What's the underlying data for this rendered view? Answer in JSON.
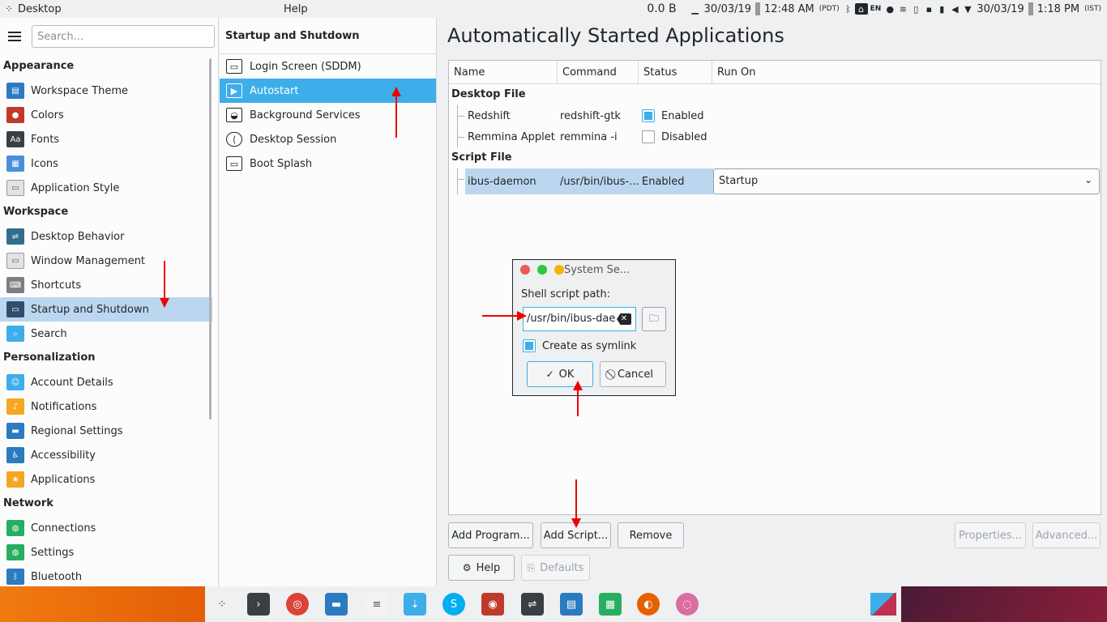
{
  "topbar": {
    "app_name": "Desktop",
    "help_menu": "Help",
    "net_speed": "0.0 B",
    "date_a": "30/03/19",
    "time_a": "12:48 AM",
    "tz_a": "(PDT)",
    "lang": "EN",
    "date_b": "30/03/19",
    "time_b": "1:18 PM",
    "tz_b": "(IST)"
  },
  "sidebar": {
    "search_placeholder": "Search...",
    "categories": [
      {
        "title": "Appearance",
        "items": [
          {
            "label": "Workspace Theme",
            "icon": "workspace-theme-icon",
            "color": "#2a7bbf"
          },
          {
            "label": "Colors",
            "icon": "colors-icon",
            "color": "#c0392b"
          },
          {
            "label": "Fonts",
            "icon": "fonts-icon",
            "color": "#3a3f44"
          },
          {
            "label": "Icons",
            "icon": "icons-icon",
            "color": "#4a90d9"
          },
          {
            "label": "Application Style",
            "icon": "application-style-icon",
            "color": "#dfe3e6"
          }
        ]
      },
      {
        "title": "Workspace",
        "items": [
          {
            "label": "Desktop Behavior",
            "icon": "desktop-behavior-icon",
            "color": "#2f6e8e"
          },
          {
            "label": "Window Management",
            "icon": "window-management-icon",
            "color": "#dfe3e6"
          },
          {
            "label": "Shortcuts",
            "icon": "shortcuts-icon",
            "color": "#7a7f84"
          },
          {
            "label": "Startup and Shutdown",
            "icon": "startup-shutdown-icon",
            "color": "#2f4e6e"
          },
          {
            "label": "Search",
            "icon": "search-icon",
            "color": "#3daee9"
          }
        ]
      },
      {
        "title": "Personalization",
        "items": [
          {
            "label": "Account Details",
            "icon": "account-details-icon",
            "color": "#3daee9"
          },
          {
            "label": "Notifications",
            "icon": "notifications-icon",
            "color": "#f5a623"
          },
          {
            "label": "Regional Settings",
            "icon": "regional-settings-icon",
            "color": "#2a7bbf"
          },
          {
            "label": "Accessibility",
            "icon": "accessibility-icon",
            "color": "#2a7bbf"
          },
          {
            "label": "Applications",
            "icon": "applications-icon",
            "color": "#f5a623"
          }
        ]
      },
      {
        "title": "Network",
        "items": [
          {
            "label": "Connections",
            "icon": "connections-icon",
            "color": "#27ae60"
          },
          {
            "label": "Settings",
            "icon": "network-settings-icon",
            "color": "#27ae60"
          },
          {
            "label": "Bluetooth",
            "icon": "bluetooth-icon",
            "color": "#2a7bbf"
          }
        ]
      }
    ]
  },
  "midpane": {
    "title": "Startup and Shutdown",
    "items": [
      {
        "label": "Login Screen (SDDM)",
        "icon": "login-screen-icon"
      },
      {
        "label": "Autostart",
        "icon": "autostart-icon"
      },
      {
        "label": "Background Services",
        "icon": "background-services-icon"
      },
      {
        "label": "Desktop Session",
        "icon": "desktop-session-icon"
      },
      {
        "label": "Boot Splash",
        "icon": "boot-splash-icon"
      }
    ]
  },
  "main": {
    "title": "Automatically Started Applications",
    "columns": [
      "Name",
      "Command",
      "Status",
      "Run On"
    ],
    "desktop_group": "Desktop File",
    "desktop_rows": [
      {
        "name": "Redshift",
        "command": "redshift-gtk",
        "status": "Enabled",
        "checked": true
      },
      {
        "name": "Remmina Applet",
        "command": "remmina -i",
        "status": "Disabled",
        "checked": false
      }
    ],
    "script_group": "Script File",
    "script_rows": [
      {
        "name": "ibus-daemon",
        "command": "/usr/bin/ibus-...",
        "status": "Enabled",
        "run_on": "Startup"
      }
    ],
    "buttons": {
      "add_program": "Add Program...",
      "add_script": "Add Script...",
      "remove": "Remove",
      "properties": "Properties...",
      "advanced": "Advanced...",
      "help": "Help",
      "defaults": "Defaults"
    }
  },
  "dialog": {
    "title": "System Se...",
    "label": "Shell script path:",
    "path_value": "/usr/bin/ibus-dae",
    "symlink_label": "Create as symlink",
    "ok": "OK",
    "cancel": "Cancel"
  },
  "taskbar": {
    "apps": [
      "application-launcher-icon",
      "terminal-icon",
      "chrome-icon",
      "file-manager-icon",
      "text-editor-icon",
      "store-icon",
      "skype-icon",
      "screenshot-icon",
      "system-settings-icon",
      "document-icon",
      "spreadsheet-icon",
      "firefox-icon",
      "app-icon"
    ]
  },
  "colors": {
    "accent": "#3daee9",
    "selection": "#bbd7ef",
    "annotation_arrow": "#e00000"
  }
}
